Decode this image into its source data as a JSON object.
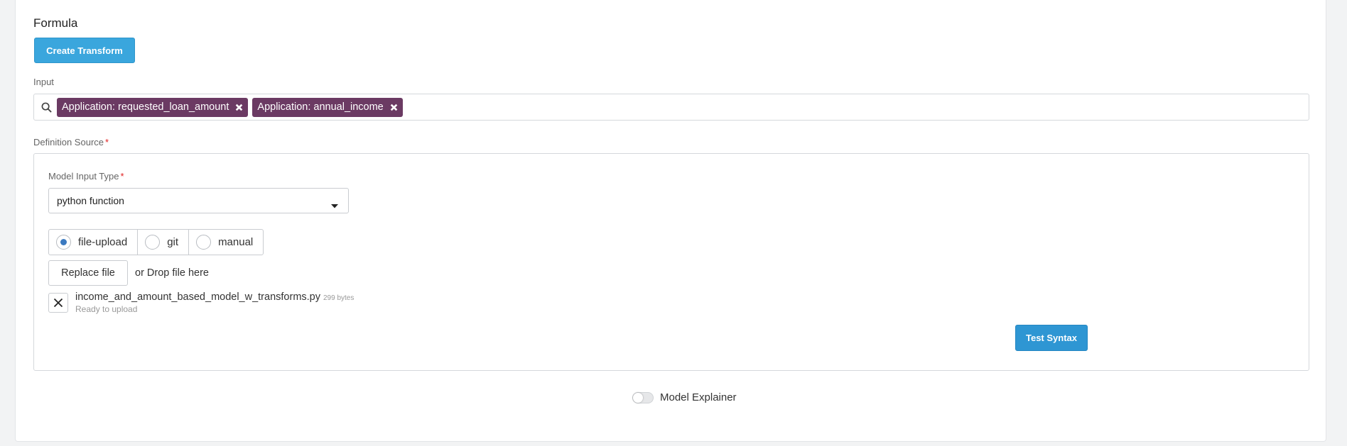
{
  "formula": {
    "title": "Formula",
    "create_transform_label": "Create Transform"
  },
  "input": {
    "label": "Input",
    "search_icon": "search-icon",
    "tags": [
      {
        "label": "Application: requested_loan_amount",
        "remove_icon": "close-icon"
      },
      {
        "label": "Application: annual_income",
        "remove_icon": "close-icon"
      }
    ]
  },
  "definition_source": {
    "label": "Definition Source",
    "required_mark": "*",
    "model_input_type": {
      "label": "Model Input Type",
      "required_mark": "*",
      "selected": "python function"
    },
    "source_options": [
      {
        "label": "file-upload",
        "selected": true
      },
      {
        "label": "git",
        "selected": false
      },
      {
        "label": "manual",
        "selected": false
      }
    ],
    "upload": {
      "replace_label": "Replace file",
      "drop_text": "or Drop file here",
      "file_name": "income_and_amount_based_model_w_transforms.py",
      "file_size": "299 bytes",
      "status": "Ready to upload"
    },
    "test_syntax_label": "Test Syntax"
  },
  "model_explainer": {
    "label": "Model Explainer",
    "enabled": false
  },
  "colors": {
    "primary": "#3aa6dd",
    "tag_bg": "#6b3a63",
    "required": "#e02020",
    "radio_selected": "#3c7ac0"
  }
}
